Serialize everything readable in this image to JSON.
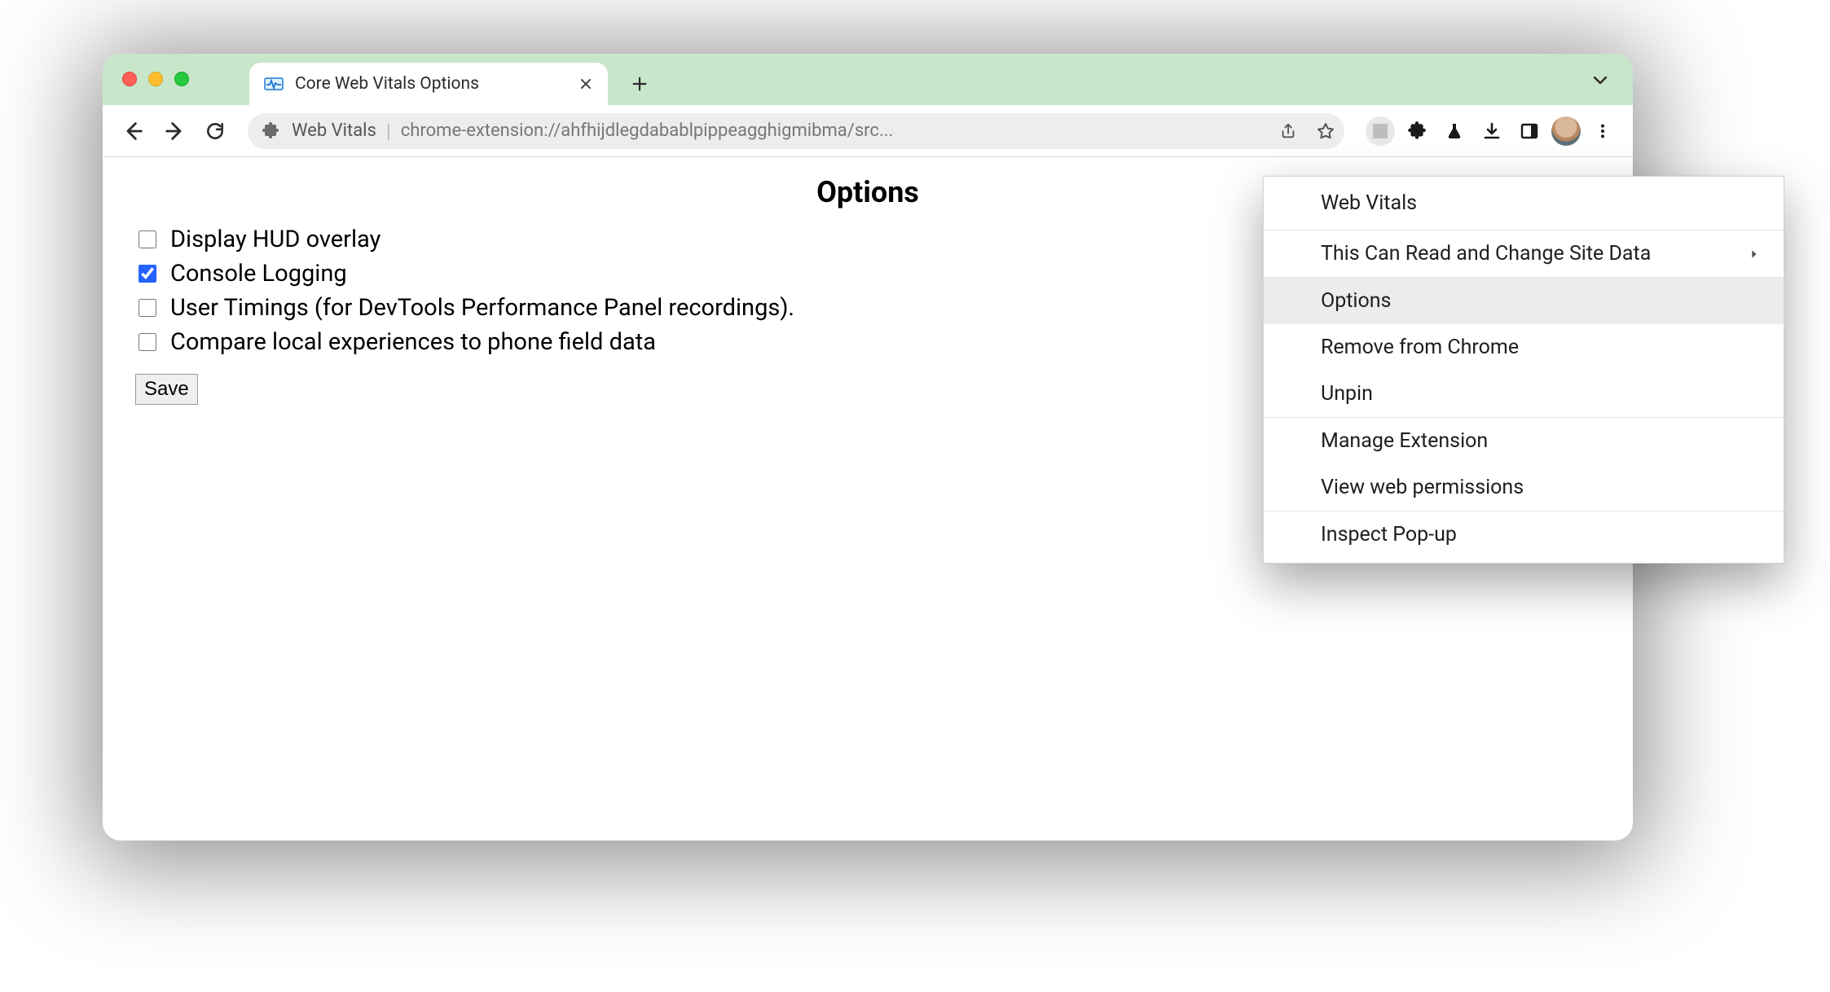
{
  "tab": {
    "title": "Core Web Vitals Options"
  },
  "omnibox": {
    "site_name": "Web Vitals",
    "url": "chrome-extension://ahfhijdlegdabablpippeagghigmibma/src..."
  },
  "page": {
    "heading": "Options",
    "options": [
      {
        "label": "Display HUD overlay",
        "checked": false
      },
      {
        "label": "Console Logging",
        "checked": true
      },
      {
        "label": "User Timings (for DevTools Performance Panel recordings).",
        "checked": false
      },
      {
        "label": "Compare local experiences to phone field data",
        "checked": false
      }
    ],
    "save_label": "Save"
  },
  "context_menu": {
    "title": "Web Vitals",
    "items": [
      {
        "label": "This Can Read and Change Site Data",
        "submenu": true,
        "group": 1
      },
      {
        "label": "Options",
        "hovered": true,
        "group": 2
      },
      {
        "label": "Remove from Chrome",
        "group": 2
      },
      {
        "label": "Unpin",
        "group": 2
      },
      {
        "label": "Manage Extension",
        "group": 3
      },
      {
        "label": "View web permissions",
        "group": 3
      },
      {
        "label": "Inspect Pop-up",
        "group": 4
      }
    ]
  }
}
